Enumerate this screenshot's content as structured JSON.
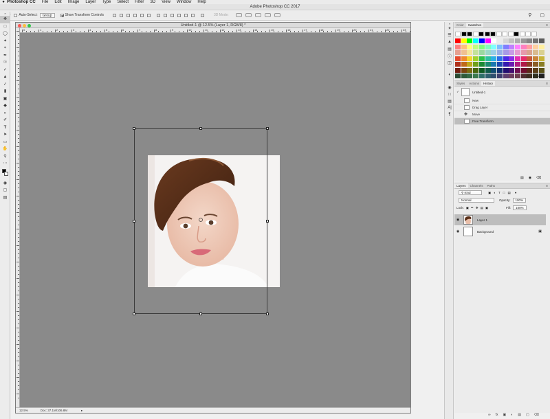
{
  "menubar": {
    "app": "Photoshop CC",
    "items": [
      "File",
      "Edit",
      "Image",
      "Layer",
      "Type",
      "Select",
      "Filter",
      "3D",
      "View",
      "Window",
      "Help"
    ]
  },
  "app_title": "Adobe Photoshop CC 2017",
  "options": {
    "auto_select_label": "Auto-Select:",
    "auto_select_value": "Group",
    "show_transform_label": "Show Transform Controls",
    "mode3d_label": "3D Mode:"
  },
  "document": {
    "title": "Untitled-1 @ 12.5% (Layer 1, RGB/8) *",
    "zoom": "12.5%",
    "doc_size": "Doc: 37.1M/106.8M",
    "ruler_labels": [
      "0",
      "1",
      "2",
      "3",
      "4",
      "5",
      "6",
      "7",
      "8",
      "9",
      "10",
      "11",
      "12",
      "13",
      "14",
      "15",
      "16",
      "17",
      "18",
      "19",
      "20",
      "21",
      "22",
      "23"
    ]
  },
  "color_panel": {
    "tabs": [
      "Color",
      "Swatches"
    ],
    "selected_tab": "Swatches"
  },
  "history_panel": {
    "tabs": [
      "Styles",
      "Actions",
      "History"
    ],
    "selected_tab": "History",
    "snapshot": "Untitled-1",
    "items": [
      {
        "label": "New",
        "selected": false
      },
      {
        "label": "Drag Layer",
        "selected": false
      },
      {
        "label": "Move",
        "selected": false
      },
      {
        "label": "Free Transform",
        "selected": true
      }
    ]
  },
  "layers_panel": {
    "tabs": [
      "Layers",
      "Channels",
      "Paths"
    ],
    "selected_tab": "Layers",
    "filter_kind": "Kind",
    "blend_mode": "Normal",
    "opacity_label": "Opacity:",
    "opacity": "100%",
    "lock_label": "Lock:",
    "fill_label": "Fill:",
    "fill": "100%",
    "layers": [
      {
        "name": "Layer 1",
        "selected": true
      },
      {
        "name": "Background",
        "selected": false
      }
    ]
  },
  "colors": {
    "canvas_bg": "#8a8a8a",
    "selected_row": "#bdbdbd"
  }
}
